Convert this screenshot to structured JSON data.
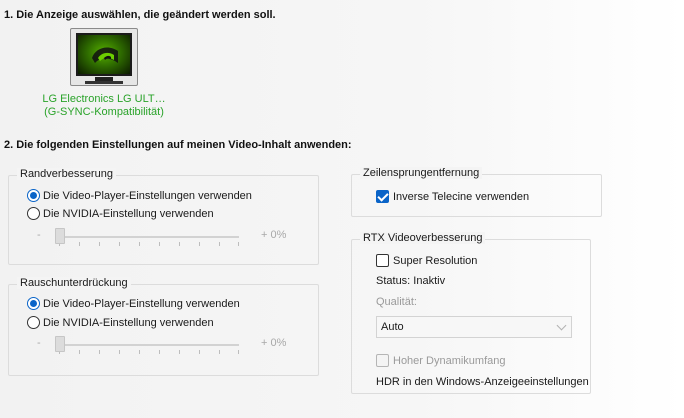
{
  "colors": {
    "accent": "#0a64c8",
    "display_label": "#2aa32a",
    "disabled_text": "#9a9a9a"
  },
  "section1": {
    "heading": "1. Die Anzeige auswählen, die geändert werden soll.",
    "display": {
      "icon": "nvidia-monitor-icon",
      "name": "LG Electronics LG ULT…",
      "subtitle": "(G-SYNC-Kompatibilität)"
    }
  },
  "section2": {
    "heading": "2. Die folgenden Einstellungen auf meinen Video-Inhalt anwenden:"
  },
  "edge_enhancement": {
    "title": "Randverbesserung",
    "option_player": "Die Video-Player-Einstellungen verwenden",
    "option_nvidia": "Die NVIDIA-Einstellung verwenden",
    "selected": "player",
    "slider": {
      "minus": "-",
      "value_label": "+ 0%",
      "value": 0
    }
  },
  "noise_reduction": {
    "title": "Rauschunterdrückung",
    "option_player": "Die Video-Player-Einstellung verwenden",
    "option_nvidia": "Die NVIDIA-Einstellung verwenden",
    "selected": "player",
    "slider": {
      "minus": "-",
      "value_label": "+ 0%",
      "value": 0
    }
  },
  "deinterlacing": {
    "title": "Zeilensprungentfernung",
    "inverse_telecine_label": "Inverse Telecine verwenden",
    "inverse_telecine_checked": true
  },
  "rtx_video": {
    "title": "RTX Videoverbesserung",
    "super_resolution_label": "Super Resolution",
    "super_resolution_checked": false,
    "status": "Status: Inaktiv",
    "quality_label": "Qualität:",
    "quality_value": "Auto",
    "hdr_label": "Hoher Dynamikumfang",
    "hdr_checked": false,
    "hdr_note": "HDR in den Windows-Anzeigeeinstellungen"
  }
}
